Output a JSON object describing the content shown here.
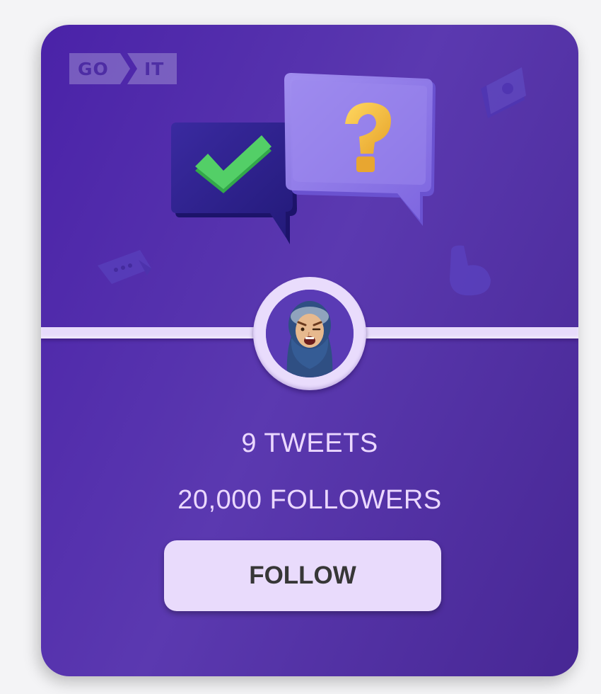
{
  "logo": {
    "go": "GO",
    "it": "IT"
  },
  "stats": {
    "tweets": "9 TWEETS",
    "followers": "20,000 FOLLOWERS"
  },
  "follow_button": {
    "label": "FOLLOW"
  },
  "colors": {
    "card_bg": "#5736a7",
    "divider": "#e7dbfb",
    "stat_text": "#ebd8ff",
    "button_bg": "#e9dbfc",
    "button_text": "#373737"
  },
  "icons": [
    "checkmark-bubble-icon",
    "question-bubble-icon",
    "avatar"
  ]
}
